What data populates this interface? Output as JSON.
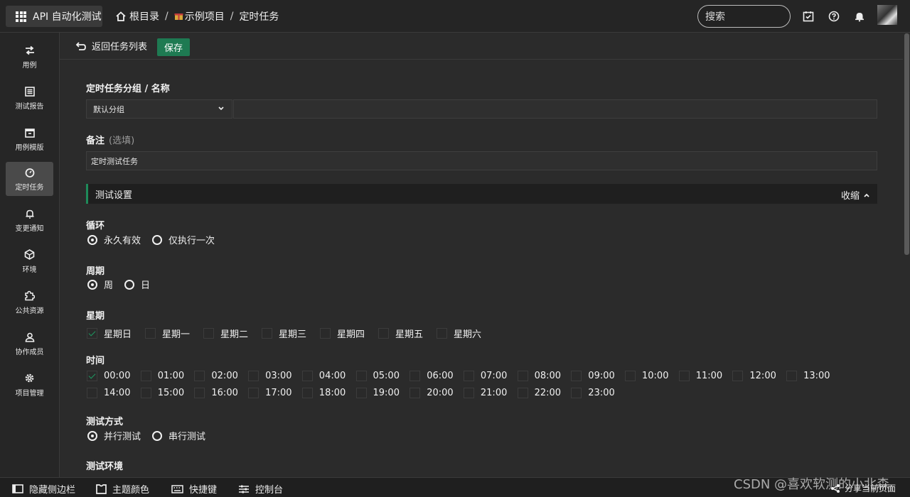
{
  "topbar": {
    "app_label": "API 自动化测试",
    "breadcrumb": {
      "home": "根目录",
      "project": "示例项目",
      "current": "定时任务",
      "sep": "/"
    },
    "search_placeholder": "搜索"
  },
  "sidebar": {
    "items": [
      {
        "label": "用例",
        "icon": "swap-icon",
        "active": false
      },
      {
        "label": "测试报告",
        "icon": "report-icon",
        "active": false
      },
      {
        "label": "用例模版",
        "icon": "template-icon",
        "active": false
      },
      {
        "label": "定时任务",
        "icon": "timer-icon",
        "active": true
      },
      {
        "label": "变更通知",
        "icon": "bell-icon",
        "active": false
      },
      {
        "label": "环境",
        "icon": "cube-icon",
        "active": false
      },
      {
        "label": "公共资源",
        "icon": "puzzle-icon",
        "active": false
      },
      {
        "label": "协作成员",
        "icon": "person-icon",
        "active": false
      },
      {
        "label": "项目管理",
        "icon": "gear-icon",
        "active": false
      }
    ]
  },
  "toolbar": {
    "back_label": "返回任务列表",
    "save_label": "保存"
  },
  "form": {
    "group_label": "定时任务分组 / 名称",
    "group_select": "默认分组",
    "name_value": "",
    "note_label": "备注",
    "note_hint": "(选填)",
    "note_value": "定时测试任务",
    "section_title": "测试设置",
    "collapse_label": "收缩",
    "loop_label": "循环",
    "loop_options": [
      {
        "label": "永久有效",
        "checked": true
      },
      {
        "label": "仅执行一次",
        "checked": false
      }
    ],
    "period_label": "周期",
    "period_options": [
      {
        "label": "周",
        "checked": true
      },
      {
        "label": "日",
        "checked": false
      }
    ],
    "weekday_label": "星期",
    "weekdays": [
      {
        "label": "星期日",
        "checked": true
      },
      {
        "label": "星期一",
        "checked": false
      },
      {
        "label": "星期二",
        "checked": false
      },
      {
        "label": "星期三",
        "checked": false
      },
      {
        "label": "星期四",
        "checked": false
      },
      {
        "label": "星期五",
        "checked": false
      },
      {
        "label": "星期六",
        "checked": false
      }
    ],
    "time_label": "时间",
    "times": [
      {
        "label": "00:00",
        "checked": true
      },
      {
        "label": "01:00",
        "checked": false
      },
      {
        "label": "02:00",
        "checked": false
      },
      {
        "label": "03:00",
        "checked": false
      },
      {
        "label": "04:00",
        "checked": false
      },
      {
        "label": "05:00",
        "checked": false
      },
      {
        "label": "06:00",
        "checked": false
      },
      {
        "label": "07:00",
        "checked": false
      },
      {
        "label": "08:00",
        "checked": false
      },
      {
        "label": "09:00",
        "checked": false
      },
      {
        "label": "10:00",
        "checked": false
      },
      {
        "label": "11:00",
        "checked": false
      },
      {
        "label": "12:00",
        "checked": false
      },
      {
        "label": "13:00",
        "checked": false
      },
      {
        "label": "14:00",
        "checked": false
      },
      {
        "label": "15:00",
        "checked": false
      },
      {
        "label": "16:00",
        "checked": false
      },
      {
        "label": "17:00",
        "checked": false
      },
      {
        "label": "18:00",
        "checked": false
      },
      {
        "label": "19:00",
        "checked": false
      },
      {
        "label": "20:00",
        "checked": false
      },
      {
        "label": "21:00",
        "checked": false
      },
      {
        "label": "22:00",
        "checked": false
      },
      {
        "label": "23:00",
        "checked": false
      }
    ],
    "mode_label": "测试方式",
    "mode_options": [
      {
        "label": "并行测试",
        "checked": true
      },
      {
        "label": "串行测试",
        "checked": false
      }
    ],
    "env_label": "测试环境"
  },
  "bottombar": {
    "hide_sidebar": "隐藏侧边栏",
    "theme": "主题颜色",
    "shortcuts": "快捷键",
    "console": "控制台",
    "share": "分享当前页面"
  },
  "watermark": "CSDN @喜欢软测的小北森",
  "colors": {
    "accent": "#1e7a52",
    "background": "#2b2b2b",
    "sidebar": "#262626"
  }
}
